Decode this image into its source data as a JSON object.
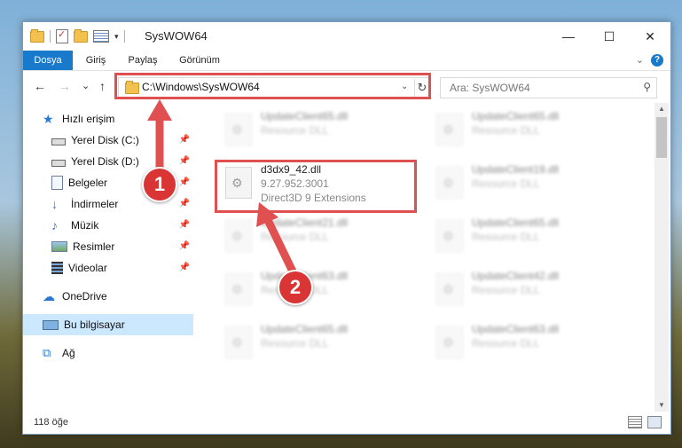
{
  "window": {
    "title": "SysWOW64",
    "minimize_glyph": "—",
    "maximize_glyph": "☐",
    "close_glyph": "✕"
  },
  "ribbon": {
    "tabs": [
      "Dosya",
      "Giriş",
      "Paylaş",
      "Görünüm"
    ]
  },
  "nav": {
    "back_glyph": "←",
    "forward_glyph": "→",
    "recent_glyph": "⌄",
    "up_glyph": "↑",
    "address": "C:\\Windows\\SysWOW64",
    "refresh_glyph": "↻",
    "search_placeholder": "Ara: SysWOW64"
  },
  "sidebar": {
    "items": [
      {
        "label": "Hızlı erişim",
        "icon": "star-icon"
      },
      {
        "label": "Yerel Disk (C:)",
        "icon": "drive-icon"
      },
      {
        "label": "Yerel Disk (D:)",
        "icon": "drive-icon"
      },
      {
        "label": "Belgeler",
        "icon": "documents-icon"
      },
      {
        "label": "İndirmeler",
        "icon": "download-icon"
      },
      {
        "label": "Müzik",
        "icon": "music-icon"
      },
      {
        "label": "Resimler",
        "icon": "pictures-icon"
      },
      {
        "label": "Videolar",
        "icon": "video-icon"
      },
      {
        "label": "OneDrive",
        "icon": "cloud-icon"
      },
      {
        "label": "Bu bilgisayar",
        "icon": "computer-icon"
      },
      {
        "label": "Ağ",
        "icon": "network-icon"
      }
    ]
  },
  "files": {
    "highlighted": {
      "name": "d3dx9_42.dll",
      "version": "9.27.952.3001",
      "description": "Direct3D 9 Extensions"
    },
    "background": [
      {
        "name": "UpdateClient65.dll",
        "desc": "Resource DLL"
      },
      {
        "name": "UpdateClient65.dll",
        "desc": "Resource DLL"
      },
      {
        "name": "UpdateClient19.dll",
        "desc": "Resource DLL"
      },
      {
        "name": "UpdateClient21.dll",
        "desc": "Resource DLL"
      },
      {
        "name": "UpdateClient65.dll",
        "desc": "Resource DLL"
      },
      {
        "name": "UpdateClient63.dll",
        "desc": "Resource DLL"
      },
      {
        "name": "UpdateClient42.dll",
        "desc": "Resource DLL"
      },
      {
        "name": "UpdateClient65.dll",
        "desc": "Resource DLL"
      },
      {
        "name": "UpdateClient63.dll",
        "desc": "Resource DLL"
      }
    ]
  },
  "status": {
    "count": "118 öğe"
  },
  "annotations": {
    "step1": "1",
    "step2": "2",
    "color": "#e05050"
  }
}
